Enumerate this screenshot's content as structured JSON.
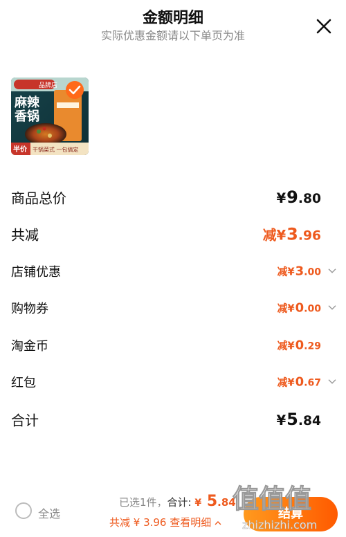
{
  "header": {
    "title": "金额明细",
    "subtitle": "实际优惠金额请以下单页为准"
  },
  "product": {
    "image_text": {
      "shop": "品牌店",
      "name_line1": "麻辣",
      "name_line2": "香锅",
      "badge": "半价",
      "tagline": "干锅菜式 一包搞定"
    }
  },
  "rows": [
    {
      "label": "商品总价",
      "value_prefix": "¥",
      "value_int": "9",
      "value_dec": ".80"
    },
    {
      "label": "共减",
      "value_prefix": "减¥",
      "value_int": "3",
      "value_dec": ".96"
    },
    {
      "label": "店铺优惠",
      "value_prefix": "减¥",
      "value_int": "3",
      "value_dec": ".00"
    },
    {
      "label": "购物券",
      "value_prefix": "减¥",
      "value_int": "0",
      "value_dec": ".00"
    },
    {
      "label": "淘金币",
      "value_prefix": "减¥",
      "value_int": "0",
      "value_dec": ".29"
    },
    {
      "label": "红包",
      "value_prefix": "减¥",
      "value_int": "0",
      "value_dec": ".67"
    },
    {
      "label": "合计",
      "value_prefix": "¥",
      "value_int": "5",
      "value_dec": ".84"
    }
  ],
  "footer": {
    "select_all": "全选",
    "selected_text": "已选1件，",
    "total_label": "合计:",
    "total_currency": "¥",
    "total_int": "5",
    "total_dec": ".84",
    "discount_text": "共减 ¥ 3.96",
    "detail_link": "查看明细",
    "checkout_label": "结算"
  },
  "watermark": {
    "site": "zhizhizhi.com",
    "logo": "值值值"
  },
  "colors": {
    "accent": "#ee5a1e",
    "checkout_gradient_start": "#ff9a1e",
    "checkout_gradient_end": "#ff5a00"
  }
}
